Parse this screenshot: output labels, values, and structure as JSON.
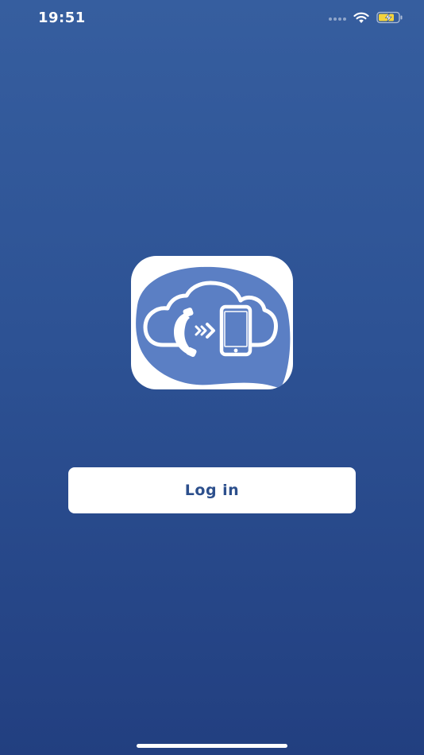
{
  "status_bar": {
    "time": "19:51",
    "icons": [
      "cellular-signal-icon",
      "wifi-icon",
      "battery-charging-icon"
    ]
  },
  "app_logo": {
    "icon": "cloud-call-forward-icon",
    "colors": {
      "background": "#ffffff",
      "blob": "#5b7fc4",
      "outline": "#ffffff"
    }
  },
  "login": {
    "label": "Log in"
  },
  "colors": {
    "gradient_top": "#365e9f",
    "gradient_bottom": "#223f80",
    "button_text": "#2c4f8c",
    "battery_fill": "#f4d33b"
  }
}
